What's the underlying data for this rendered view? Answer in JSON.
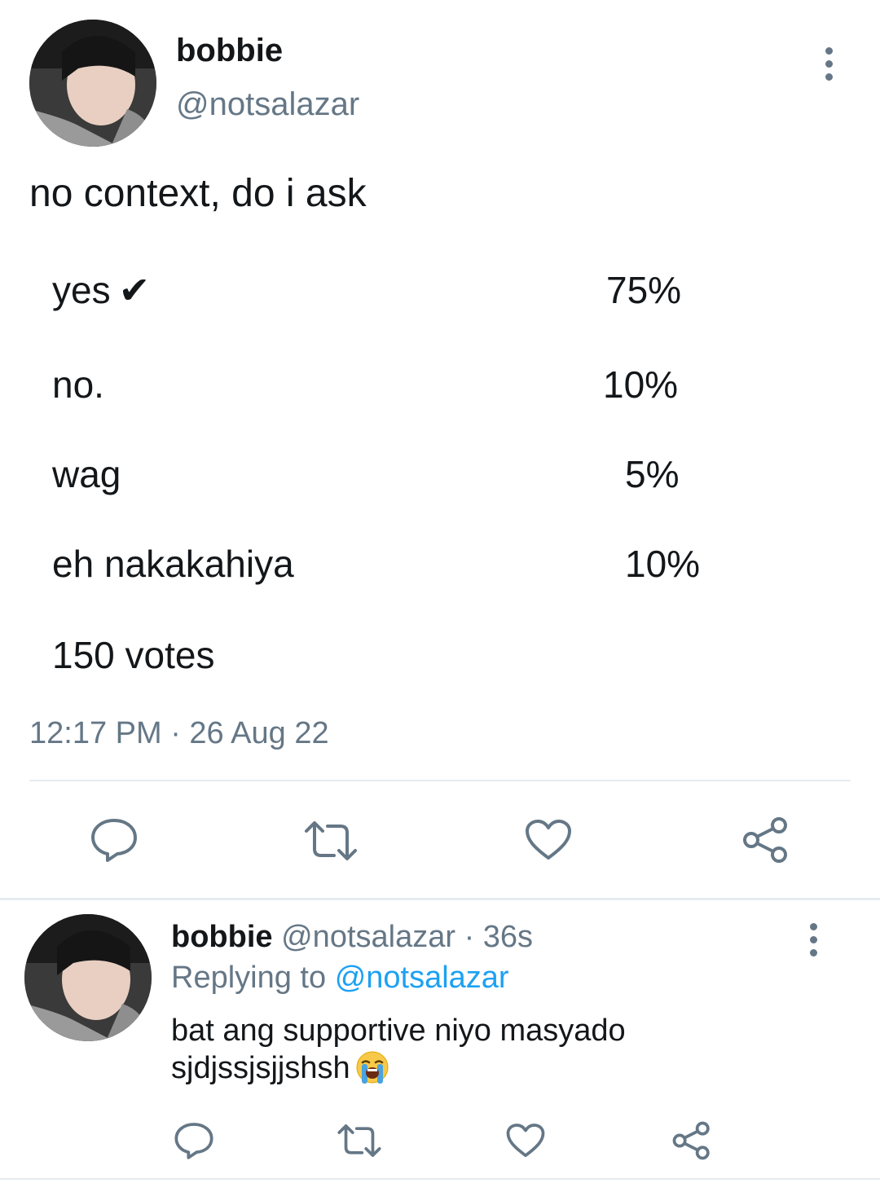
{
  "tweet": {
    "author_name": "bobbie",
    "handle": "@notsalazar",
    "text": "no context, do i ask",
    "poll": {
      "options": [
        {
          "label": "yes",
          "percent": "75%",
          "winner_mark": "✔"
        },
        {
          "label": "no.",
          "percent": "10%"
        },
        {
          "label": "wag",
          "percent": "5%"
        },
        {
          "label": "eh nakakahiya",
          "percent": "10%"
        }
      ],
      "votes": "150 votes"
    },
    "timestamp": "12:17 PM · 26 Aug 22",
    "actions": [
      "reply-icon",
      "retweet-icon",
      "like-icon",
      "share-icon"
    ]
  },
  "reply": {
    "author_name": "bobbie",
    "handle": "@notsalazar",
    "time": "· 36s",
    "replying_prefix": "Replying to",
    "replying_to": "@notsalazar",
    "text_line1": "bat ang supportive niyo masyado",
    "text_line2": "sjdjssjsjjshsh",
    "emoji": "loudly-crying-face",
    "actions": [
      "reply-icon",
      "retweet-icon",
      "like-icon",
      "share-icon"
    ]
  },
  "colors": {
    "text": "#14171a",
    "secondary": "#657786",
    "link": "#1da1f2",
    "divider": "#e6ecf0"
  }
}
